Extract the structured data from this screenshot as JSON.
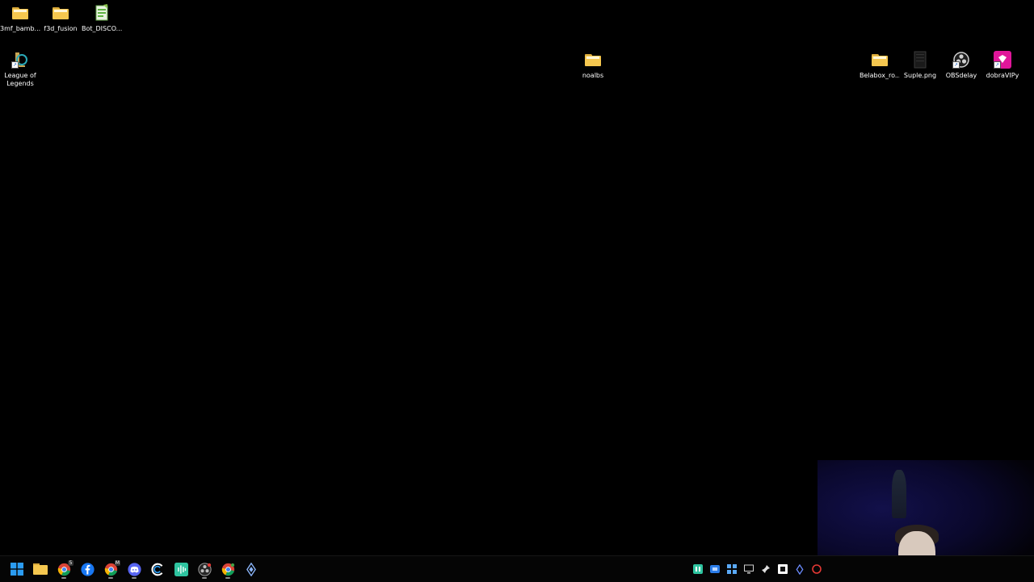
{
  "desktop": {
    "icons": [
      {
        "key": "3mf",
        "label": "3mf_bamb...",
        "type": "folder"
      },
      {
        "key": "f3d",
        "label": "f3d_fusion",
        "type": "folder"
      },
      {
        "key": "bot",
        "label": "Bot_DISCO...",
        "type": "file"
      },
      {
        "key": "lol",
        "label": "League of Legends",
        "type": "app"
      },
      {
        "key": "noalbs",
        "label": "noalbs",
        "type": "folder"
      },
      {
        "key": "belabox",
        "label": "Belabox_ro...",
        "type": "folder"
      },
      {
        "key": "suple",
        "label": "Suple.png",
        "type": "image"
      },
      {
        "key": "obsdelay",
        "label": "OBSdelay",
        "type": "app"
      },
      {
        "key": "dobravipy",
        "label": "dobraVIPy",
        "type": "app"
      }
    ]
  },
  "taskbar": {
    "pinned": [
      {
        "name": "start-button",
        "icon": "windows-logo-icon"
      },
      {
        "name": "file-explorer",
        "icon": "folder-icon"
      },
      {
        "name": "chrome-1",
        "icon": "chrome-icon",
        "badge": "5"
      },
      {
        "name": "facebook",
        "icon": "facebook-icon"
      },
      {
        "name": "chrome-2",
        "icon": "chrome-icon",
        "badge": "M"
      },
      {
        "name": "discord",
        "icon": "discord-icon"
      },
      {
        "name": "ccleaner",
        "icon": "ccleaner-icon"
      },
      {
        "name": "audio-app",
        "icon": "waveform-icon"
      },
      {
        "name": "obs",
        "icon": "obs-icon"
      },
      {
        "name": "chrome-3",
        "icon": "chrome-icon"
      },
      {
        "name": "app-diamond",
        "icon": "diamond-icon"
      }
    ],
    "tray": [
      {
        "name": "tray-green",
        "icon": "green-app-icon"
      },
      {
        "name": "tray-blue",
        "icon": "blue-app-icon"
      },
      {
        "name": "tray-grid",
        "icon": "grid-icon"
      },
      {
        "name": "tray-monitor",
        "icon": "monitor-icon"
      },
      {
        "name": "tray-pin",
        "icon": "pin-icon"
      },
      {
        "name": "tray-box",
        "icon": "box-icon"
      },
      {
        "name": "tray-diamond",
        "icon": "diamond-icon"
      },
      {
        "name": "tray-red",
        "icon": "red-app-icon"
      }
    ]
  },
  "colors": {
    "folder": "#f5c74f",
    "background": "#000000",
    "taskbar": "#050505",
    "windows_blue": "#2b9cf2",
    "facebook_blue": "#1877f2",
    "discord": "#5865f2"
  }
}
